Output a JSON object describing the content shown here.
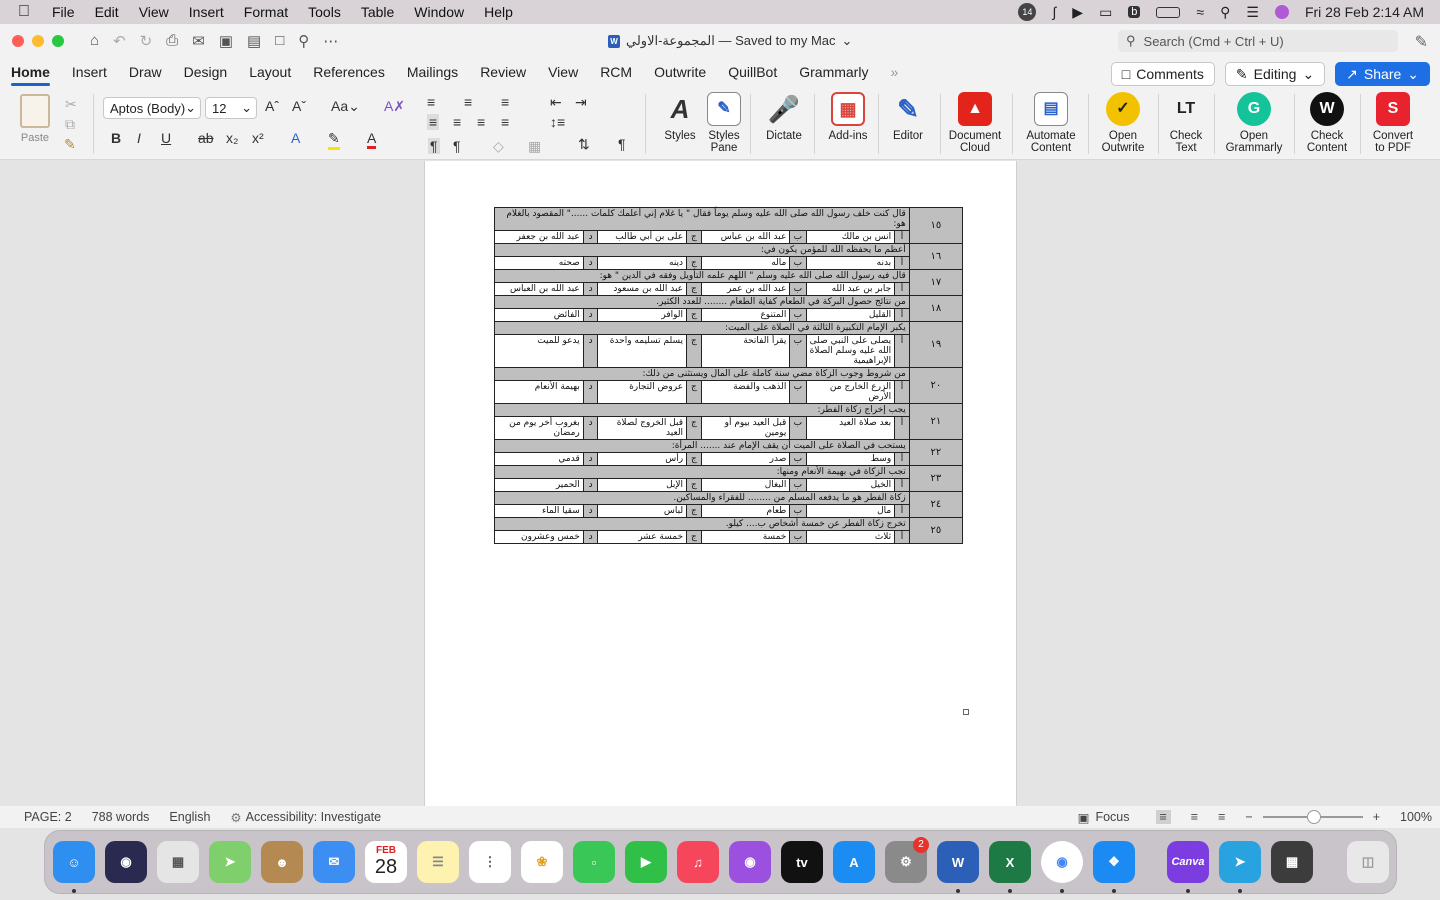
{
  "menubar": {
    "app": "Word",
    "items": [
      "File",
      "Edit",
      "View",
      "Insert",
      "Format",
      "Tools",
      "Table",
      "Window",
      "Help"
    ],
    "badge": "14",
    "datetime": "Fri 28 Feb  2:14 AM"
  },
  "titlebar": {
    "doc_title": "المجموعة-الاولي — Saved to my Mac",
    "search_placeholder": "Search (Cmd + Ctrl + U)"
  },
  "tabs": [
    "Home",
    "Insert",
    "Draw",
    "Design",
    "Layout",
    "References",
    "Mailings",
    "Review",
    "View",
    "RCM",
    "Outwrite",
    "QuillBot",
    "Grammarly"
  ],
  "tabbuttons": {
    "comments": "Comments",
    "editing": "Editing",
    "share": "Share"
  },
  "ribbon": {
    "paste": "Paste",
    "font": "Aptos (Body)",
    "size": "12",
    "buttons": [
      {
        "label1": "Styles",
        "label2": ""
      },
      {
        "label1": "Styles",
        "label2": "Pane"
      },
      {
        "label1": "Dictate",
        "label2": ""
      },
      {
        "label1": "Add-ins",
        "label2": ""
      },
      {
        "label1": "Editor",
        "label2": ""
      },
      {
        "label1": "Document",
        "label2": "Cloud"
      },
      {
        "label1": "Automate",
        "label2": "Content"
      },
      {
        "label1": "Open",
        "label2": "Outwrite"
      },
      {
        "label1": "Check",
        "label2": "Text"
      },
      {
        "label1": "Open",
        "label2": "Grammarly"
      },
      {
        "label1": "Check",
        "label2": "Content"
      },
      {
        "label1": "Convert",
        "label2": "to PDF"
      }
    ]
  },
  "questions": [
    {
      "num": "١٥",
      "q": "قال كنت خلف رسول الله صلى الله عليه وسلم يوماً فقال \" يا غلام إني أعلمك كلمات ......\" المقصود بالغلام هو:",
      "a": "انس بن مالك",
      "b": "عبد الله بن عباس",
      "c": "على بن أبي طالب",
      "d": "عبد الله بن جعفر"
    },
    {
      "num": "١٦",
      "q": "أعظم ما يحفظه الله للمؤمن يكون في:",
      "a": "بدنه",
      "b": "ماله",
      "c": "دينه",
      "d": "صحته"
    },
    {
      "num": "١٧",
      "q": "قال فيه رسول الله صلى الله عليه وسلم \" اللهم علمه التأويل وفقه في الدين \" هو:",
      "a": "جابر بن عبد الله",
      "b": "عبد الله بن عمر",
      "c": "عبد الله بن مسعود",
      "d": "عبد الله بن العباس"
    },
    {
      "num": "١٨",
      "q": "من نتائج حصول البركة في الطعام كفاية الطعام ........ للعدد الكثير.",
      "a": "القليل",
      "b": "المتنوع",
      "c": "الوافر",
      "d": "الفائض"
    },
    {
      "num": "١٩",
      "q": "يكبر الإمام التكبيرة الثالثة في الصلاة على الميت:",
      "a": "يصلى على النبي صلى الله عليه وسلم الصلاة الإبراهيمية",
      "b": "يقرأ الفاتحة",
      "c": "يسلم تسليمه واحدة",
      "d": "يدعو للميت"
    },
    {
      "num": "٢٠",
      "q": "من شروط وجوب الزكاة مضي سنة كاملة على المال ويستثنى من ذلك:",
      "a": "الزرع الخارج من الأرض",
      "b": "الذهب والفضة",
      "c": "عروض التجارة",
      "d": "بهيمة الأنعام"
    },
    {
      "num": "٢١",
      "q": "يجب إخراج زكاة الفطر:",
      "a": "بعد صلاة العيد",
      "b": "قبل العيد بيوم أو يومين",
      "c": "قبل الخروج لصلاة العيد",
      "d": "بغروب أخر يوم من رمضان"
    },
    {
      "num": "٢٢",
      "q": "يستحب في الصلاة على الميت أن يقف الإمام عند ....... المرأة:",
      "a": "وسط",
      "b": "صدر",
      "c": "رأس",
      "d": "قدمي"
    },
    {
      "num": "٢٣",
      "q": "تجب الزكاة في بهيمة الأنعام ومنها:",
      "a": "الخيل",
      "b": "البغال",
      "c": "الإبل",
      "d": "الحمير"
    },
    {
      "num": "٢٤",
      "q": "زكاة الفطر هو ما يدفعه المسلم من ........ للفقراء والمساكين.",
      "a": "مال",
      "b": "طعام",
      "c": "لباس",
      "d": "سقيا الماء"
    },
    {
      "num": "٢٥",
      "q": "تخرج زكاة الفطر عن خمسة أشخاص ب.... كيلو.",
      "a": "ثلاث",
      "b": "خمسة",
      "c": "خمسة عشر",
      "d": "خمس وعشرون"
    }
  ],
  "letters": {
    "a": "أ",
    "b": "ب",
    "c": "ج",
    "d": "د"
  },
  "status": {
    "page": "PAGE: 2",
    "words": "788 words",
    "lang": "English",
    "access": "Accessibility: Investigate",
    "focus": "Focus",
    "zoom": "100%"
  },
  "dock": {
    "calendar_month": "FEB",
    "calendar_day": "28",
    "settings_badge": "2"
  }
}
